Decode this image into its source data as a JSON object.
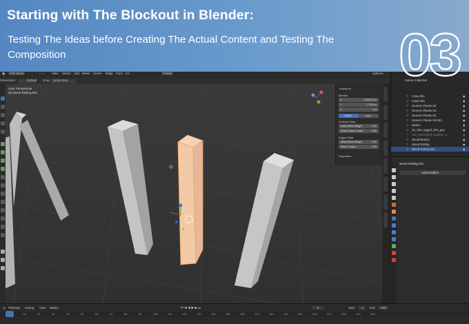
{
  "banner": {
    "title": "Starting with The Blockout in Blender:",
    "subtitle": "Testing The Ideas before Creating The Actual Content and Testing The Composition",
    "step_number": "03"
  },
  "header": {
    "mode": "Edit Mode",
    "menu": [
      "View",
      "Select",
      "Add",
      "Mesh",
      "Vertex",
      "Edge",
      "Face",
      "UV"
    ],
    "orientation_label": "Orientation:",
    "orientation_value": "Default",
    "drag_label": "Drag:",
    "drag_value": "Select Box",
    "transform_global": "Global",
    "options": "Options"
  },
  "viewport": {
    "view_name": "User Perspective",
    "object_name": "(0) Wood Railing.001"
  },
  "npanel": {
    "section": "Transform",
    "median_label": "Median:",
    "x": "0.004474 m",
    "y": "7.7224 m",
    "z": "1 m",
    "global": "Global",
    "local": "Local",
    "vertices_data": "Vertices Data:",
    "mean_bevel_weight": "Mean Bevel Weight",
    "mean_vertex_crease": "Mean Vertex Crease",
    "edges_data": "Edges Data:",
    "mean_bevel_weight_2": "Mean Bevel Weight",
    "mean_crease": "Mean Crease",
    "zero": "0.00",
    "properties": "Properties"
  },
  "outliner": {
    "header": "Scene Collection",
    "rows": [
      "Cube.001",
      "Cube.003",
      "Generic Planks 02",
      "Generic Planks 03",
      "Generic Planks 03",
      "Generic Planks 03.001",
      "Model",
      "Ss_dmt_rigged_001_geo",
      "Set_SetHeightf_weather_a",
      "Wood Beams",
      "Wood Railing",
      "Wood Railing.001"
    ]
  },
  "properties": {
    "object": "Wood Railing.001",
    "add_modifier": "Add Modifier"
  },
  "timeline": {
    "menus": [
      "Playback",
      "Keying",
      "View",
      "Marker"
    ],
    "current_frame": "0",
    "start_label": "Start",
    "start": "1",
    "end_label": "End",
    "end": "250",
    "ruler": [
      "0",
      "10",
      "20",
      "30",
      "40",
      "50",
      "60",
      "70",
      "80",
      "90",
      "100",
      "110",
      "120",
      "130",
      "140",
      "150",
      "160",
      "170",
      "180",
      "190",
      "200",
      "210",
      "220",
      "230",
      "240",
      "250"
    ]
  },
  "colors": {
    "banner": "#5a8ac7",
    "selected_face": "#f2b990",
    "active_blue": "#4772b3"
  }
}
